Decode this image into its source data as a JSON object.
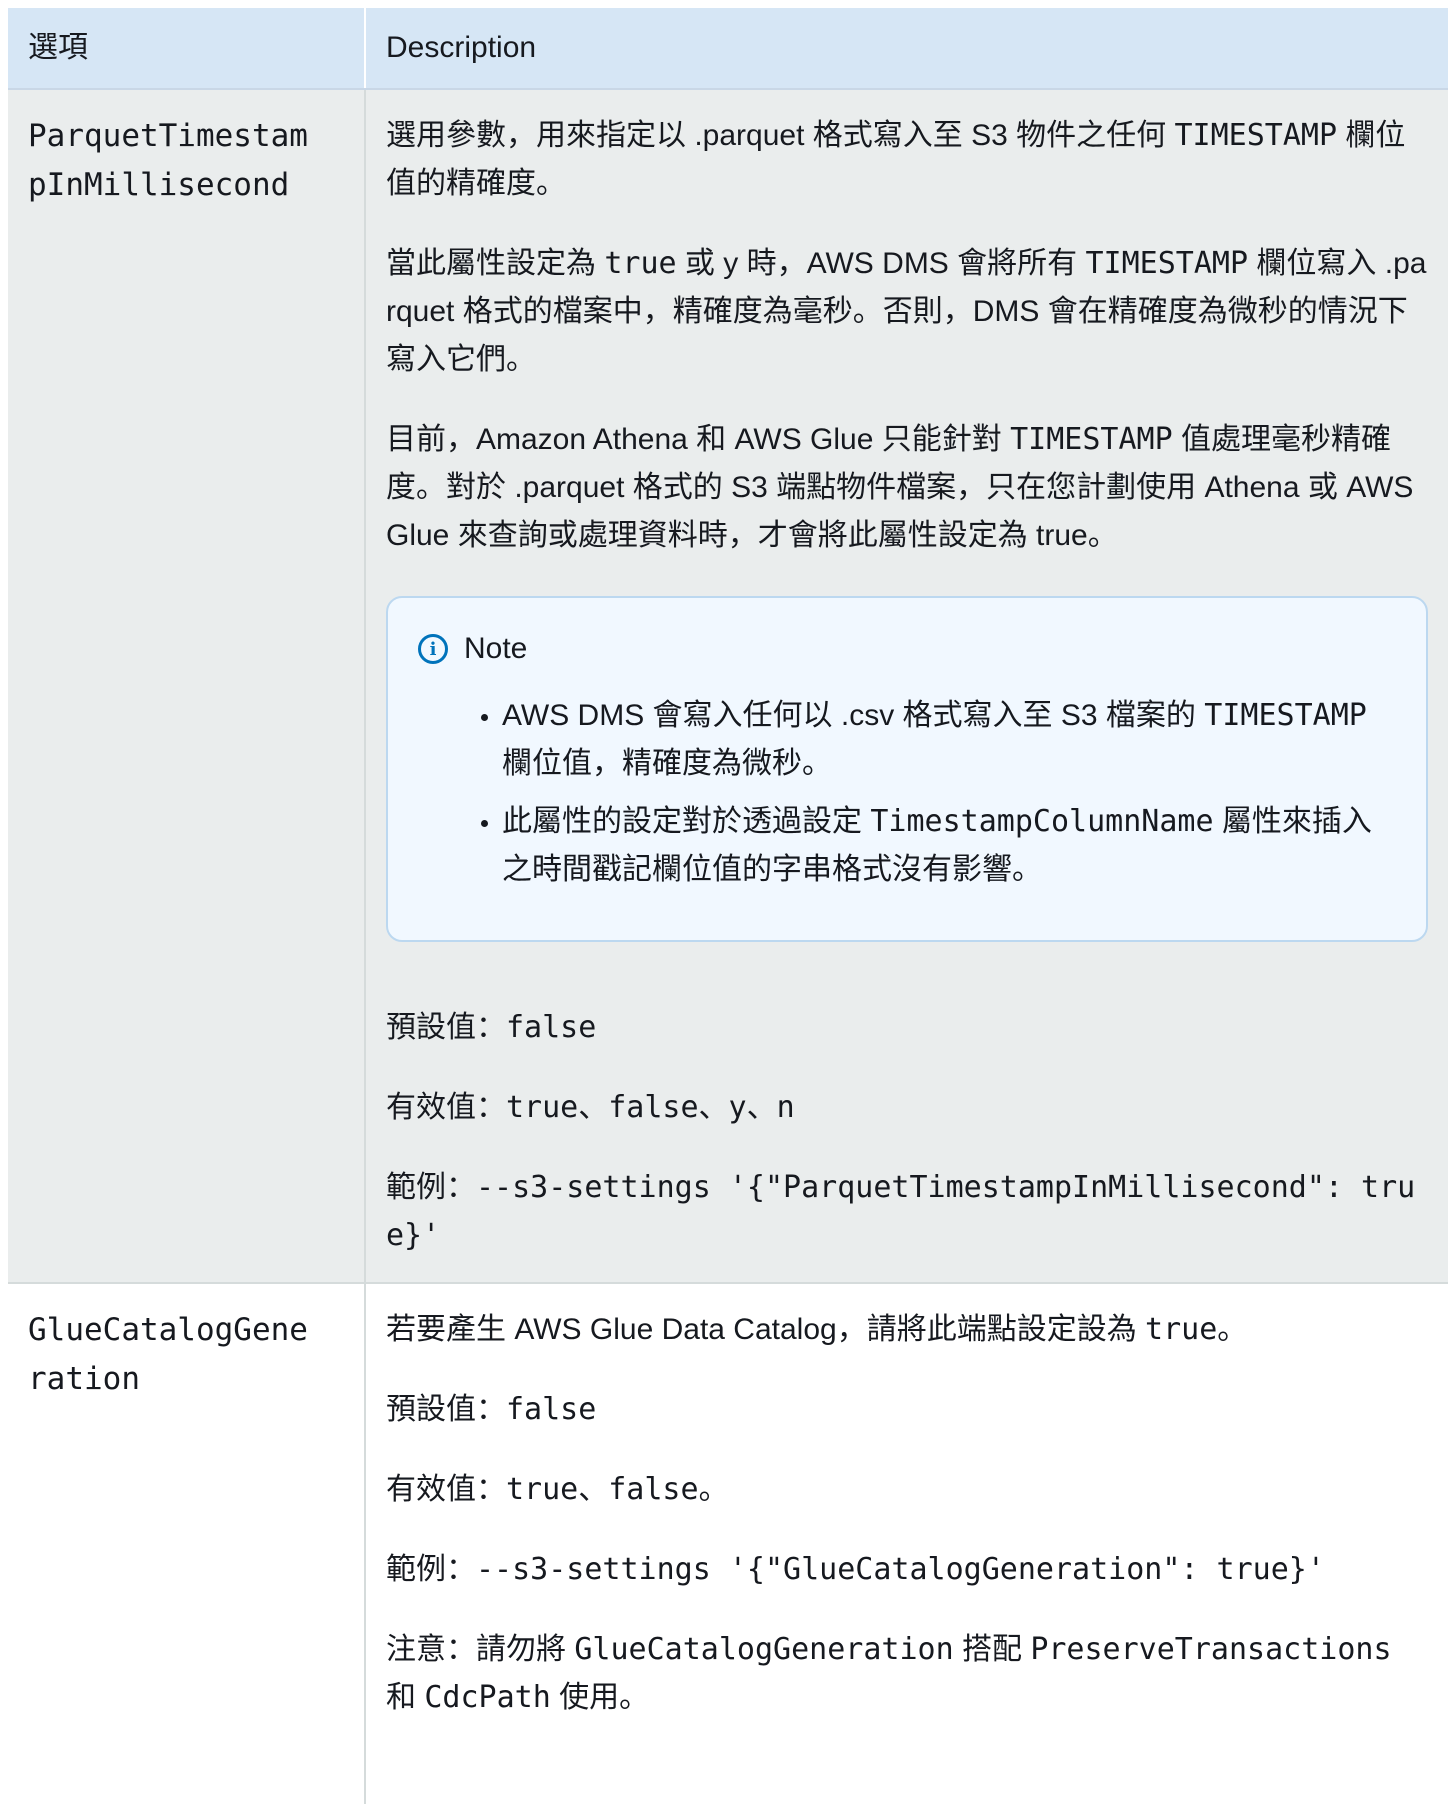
{
  "header": {
    "option_col": "選項",
    "description_col": "Description"
  },
  "rows": [
    {
      "option": "ParquetTimestampInMillisecond",
      "desc_1": {
        "a": "選用參數，用來指定以 .parquet 格式寫入至 S3 物件之任何 ",
        "code": "TIMESTAMP",
        "b": " 欄位值的精確度。"
      },
      "desc_2": {
        "a": "當此屬性設定為 ",
        "code1": "true",
        "b": " 或 y 時，AWS DMS 會將所有 ",
        "code2": "TIMESTAMP",
        "c": " 欄位寫入 .parquet 格式的檔案中，精確度為毫秒。否則，DMS 會在精確度為微秒的情況下寫入它們。"
      },
      "desc_3": {
        "a": "目前，Amazon Athena 和 AWS Glue 只能針對 ",
        "code": "TIMESTAMP",
        "b": " 值處理毫秒精確度。對於 .parquet 格式的 S3 端點物件檔案，只在您計劃使用 Athena 或 AWS Glue 來查詢或處理資料時，才會將此屬性設定為 true。"
      },
      "note": {
        "title": "Note",
        "item1": {
          "a": "AWS DMS 會寫入任何以 .csv 格式寫入至 S3 檔案的 ",
          "code": "TIMESTAMP",
          "b": " 欄位值，精確度為微秒。"
        },
        "item2": {
          "a": "此屬性的設定對於透過設定 ",
          "code": "TimestampColumnName",
          "b": " 屬性來插入之時間戳記欄位值的字串格式沒有影響。"
        }
      },
      "default": {
        "label": "預設值：",
        "value": "false"
      },
      "valid": {
        "label": "有效值：",
        "value": "true、false、y、n"
      },
      "example": {
        "label": "範例：",
        "value": "--s3-settings '{\"ParquetTimestampInMillisecond\": true}'"
      }
    },
    {
      "option": "GlueCatalogGeneration",
      "desc_1": {
        "a": "若要產生 AWS Glue Data Catalog，請將此端點設定設為 ",
        "code": "true",
        "b": "。"
      },
      "default": {
        "label": "預設值：",
        "value": "false"
      },
      "valid": {
        "label": "有效值：",
        "value": "true、false",
        "suffix": "。"
      },
      "example": {
        "label": "範例：",
        "value": "--s3-settings '{\"GlueCatalogGeneration\": true}'"
      },
      "caution": {
        "label": "注意：請勿將 ",
        "code1": "GlueCatalogGeneration",
        "a": " 搭配 ",
        "code2": "PreserveTransactions",
        "b": " 和 ",
        "code3": "CdcPath",
        "c": " 使用。"
      }
    }
  ]
}
